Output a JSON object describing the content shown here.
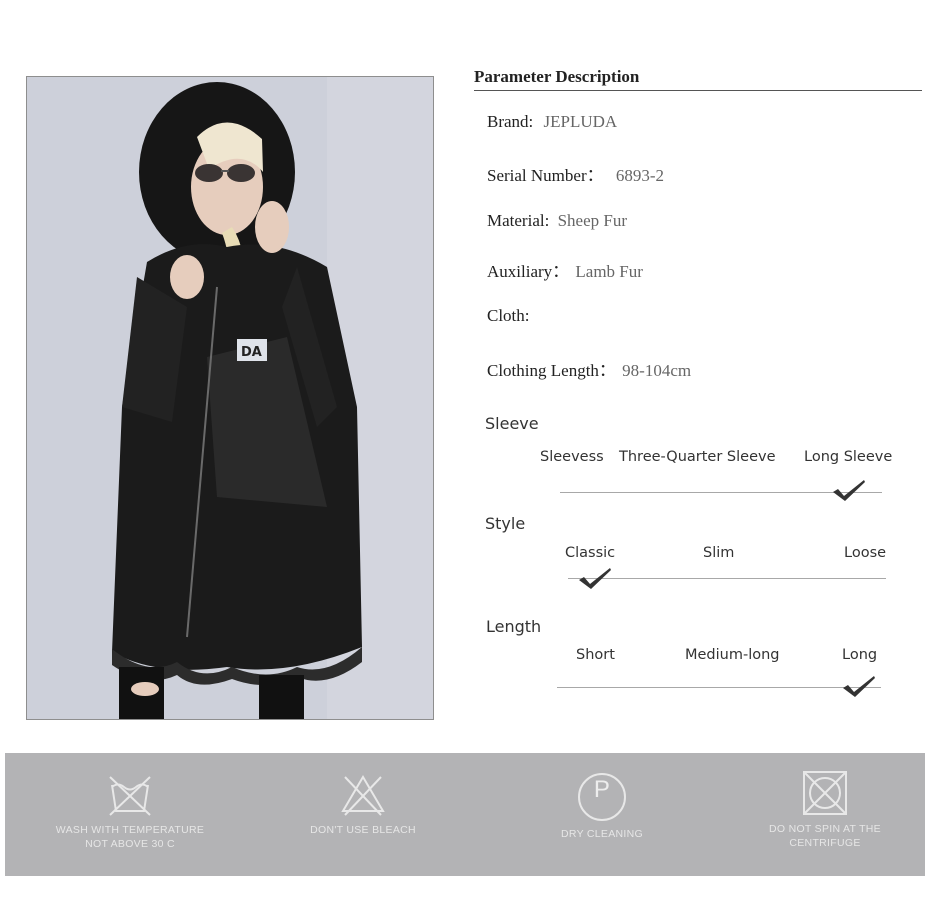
{
  "parameters": {
    "title": "Parameter Description",
    "brand": {
      "label": "Brand:",
      "value": "JEPLUDA"
    },
    "serial": {
      "label": "Serial Number：",
      "value": "6893-2"
    },
    "material": {
      "label": "Material:",
      "value": "Sheep Fur"
    },
    "auxiliary": {
      "label": "Auxiliary：",
      "value": "Lamb Fur"
    },
    "cloth": {
      "label": "Cloth:",
      "value": ""
    },
    "length": {
      "label": "Clothing Length：",
      "value": "98-104cm"
    }
  },
  "sleeve": {
    "label": "Sleeve",
    "options": [
      "Sleevess",
      "Three-Quarter Sleeve",
      "Long Sleeve"
    ],
    "selected": "Long Sleeve"
  },
  "style": {
    "label": "Style",
    "options": [
      "Classic",
      "Slim",
      "Loose"
    ],
    "selected": "Classic"
  },
  "length_scale": {
    "label": "Length",
    "options": [
      "Short",
      "Medium-long",
      "Long"
    ],
    "selected": "Long"
  },
  "care": {
    "wash": {
      "line1": "WASH WITH TEMPERATURE",
      "line2": "NOT ABOVE 30 C",
      "icon": "wash-icon"
    },
    "bleach": {
      "line1": "DON'T USE BLEACH",
      "icon": "no-bleach-icon"
    },
    "dry": {
      "line1": "DRY CLEANING",
      "icon": "dry-clean-icon",
      "symbol": "P"
    },
    "spin": {
      "line1": "DO NOT SPIN AT THE",
      "line2": "CENTRIFUGE",
      "icon": "no-tumble-dry-icon"
    }
  },
  "colors": {
    "care_band": "#b3b3b5",
    "checkmark": "#333333",
    "coat": "#1a1a1a",
    "background_photo": "#cfd1d9"
  }
}
